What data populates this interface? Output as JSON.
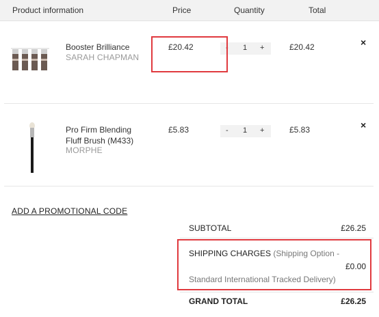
{
  "header": {
    "product": "Product information",
    "price": "Price",
    "quantity": "Quantity",
    "total": "Total"
  },
  "items": [
    {
      "name_line1": "Booster Brilliance",
      "name_line2": "",
      "brand": "SARAH CHAPMAN",
      "price": "£20.42",
      "qty_minus": "-",
      "qty": "1",
      "qty_plus": "+",
      "total": "£20.42",
      "remove": "×",
      "image": "serum-vials-image"
    },
    {
      "name_line1": "Pro Firm Blending",
      "name_line2": "Fluff Brush (M433)",
      "brand": "MORPHE",
      "price": "£5.83",
      "qty_minus": "-",
      "qty": "1",
      "qty_plus": "+",
      "total": "£5.83",
      "remove": "×",
      "image": "makeup-brush-image"
    }
  ],
  "promo": {
    "label": "ADD A PROMOTIONAL CODE"
  },
  "summary": {
    "subtotal_label": "SUBTOTAL",
    "subtotal_value": "£26.25",
    "shipping_label": "SHIPPING CHARGES",
    "shipping_note_line1": "(Shipping Option -",
    "shipping_note_line2": "Standard International Tracked Delivery)",
    "shipping_value": "£0.00",
    "grand_label": "GRAND TOTAL",
    "grand_value": "£26.25"
  },
  "colors": {
    "highlight": "#e0393e",
    "header_bg": "#f2f2f2",
    "brand_text": "#999999"
  }
}
